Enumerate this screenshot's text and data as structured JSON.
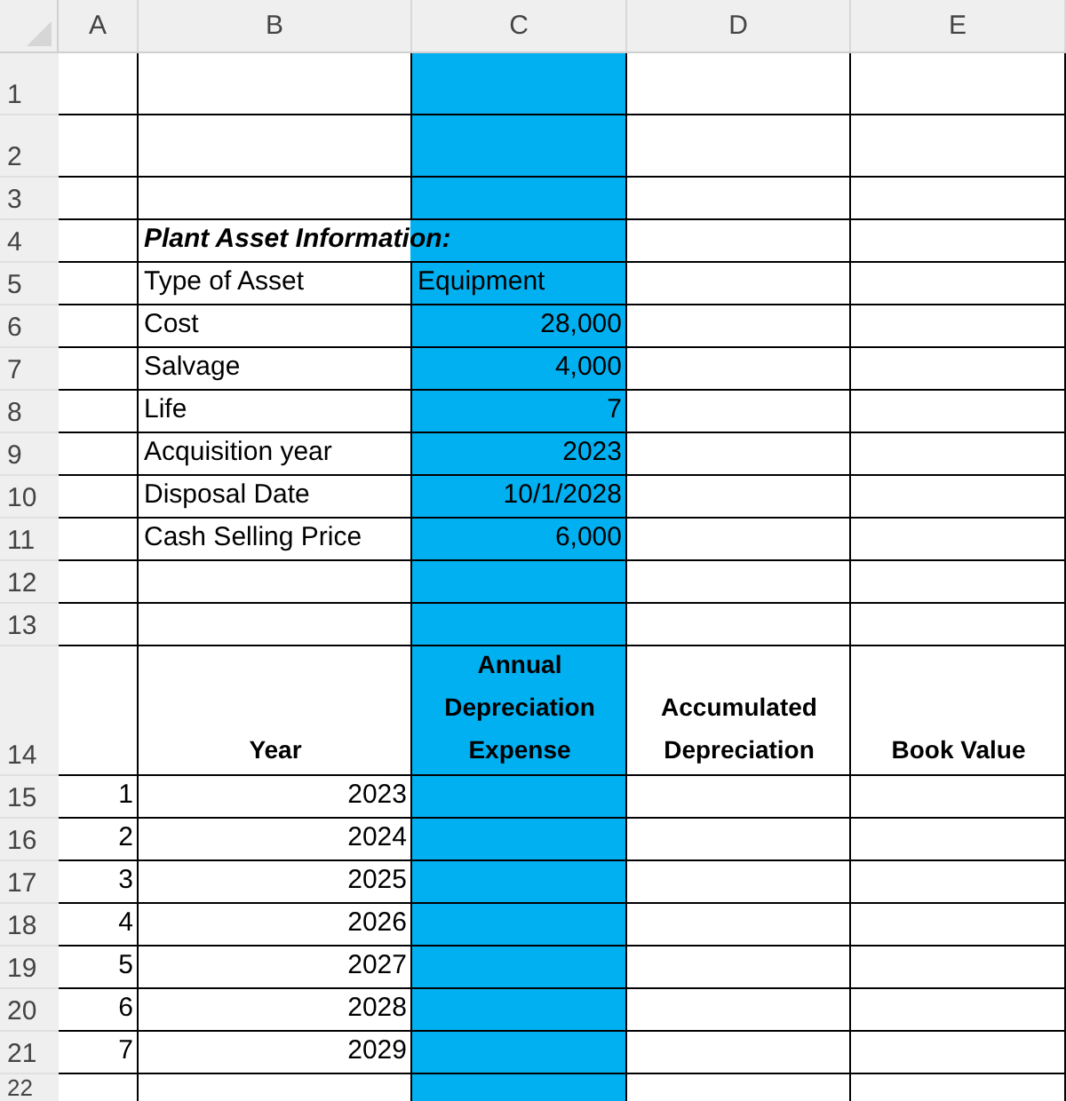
{
  "columns": [
    {
      "label": "A"
    },
    {
      "label": "B"
    },
    {
      "label": "C",
      "color": "#00b0f0"
    },
    {
      "label": "D"
    },
    {
      "label": "E"
    }
  ],
  "rows": [
    {
      "label": "1",
      "cells": {}
    },
    {
      "label": "2",
      "cells": {}
    },
    {
      "label": "3",
      "cells": {}
    },
    {
      "label": "4",
      "cells": {
        "B": {
          "text": "Plant Asset Information:",
          "kind": "title"
        }
      }
    },
    {
      "label": "5",
      "cells": {
        "B": {
          "text": "Type of Asset",
          "kind": "text"
        },
        "C": {
          "text": "Equipment",
          "kind": "text"
        }
      }
    },
    {
      "label": "6",
      "cells": {
        "B": {
          "text": "Cost",
          "kind": "text"
        },
        "C": {
          "text": "28,000",
          "kind": "number"
        }
      }
    },
    {
      "label": "7",
      "cells": {
        "B": {
          "text": "Salvage",
          "kind": "text"
        },
        "C": {
          "text": "4,000",
          "kind": "number"
        }
      }
    },
    {
      "label": "8",
      "cells": {
        "B": {
          "text": "Life",
          "kind": "text"
        },
        "C": {
          "text": "7",
          "kind": "number"
        }
      }
    },
    {
      "label": "9",
      "cells": {
        "B": {
          "text": "Acquisition year",
          "kind": "text"
        },
        "C": {
          "text": "2023",
          "kind": "number"
        }
      }
    },
    {
      "label": "10",
      "cells": {
        "B": {
          "text": "Disposal Date",
          "kind": "text"
        },
        "C": {
          "text": "10/1/2028",
          "kind": "number"
        }
      }
    },
    {
      "label": "11",
      "cells": {
        "B": {
          "text": "Cash Selling Price",
          "kind": "text"
        },
        "C": {
          "text": "6,000",
          "kind": "number"
        }
      }
    },
    {
      "label": "12",
      "cells": {}
    },
    {
      "label": "13",
      "cells": {}
    },
    {
      "label": "14",
      "cells": {
        "B": {
          "text": "Year",
          "kind": "heading"
        },
        "C": {
          "text": "Annual Depreciation Expense",
          "kind": "heading"
        },
        "D": {
          "text": "Accumulated Depreciation",
          "kind": "heading"
        },
        "E": {
          "text": "Book Value",
          "kind": "heading"
        }
      }
    },
    {
      "label": "15",
      "cells": {
        "A": {
          "text": "1",
          "kind": "number"
        },
        "B": {
          "text": "2023",
          "kind": "number"
        }
      }
    },
    {
      "label": "16",
      "cells": {
        "A": {
          "text": "2",
          "kind": "number"
        },
        "B": {
          "text": "2024",
          "kind": "number"
        }
      }
    },
    {
      "label": "17",
      "cells": {
        "A": {
          "text": "3",
          "kind": "number"
        },
        "B": {
          "text": "2025",
          "kind": "number"
        }
      }
    },
    {
      "label": "18",
      "cells": {
        "A": {
          "text": "4",
          "kind": "number"
        },
        "B": {
          "text": "2026",
          "kind": "number"
        }
      }
    },
    {
      "label": "19",
      "cells": {
        "A": {
          "text": "5",
          "kind": "number"
        },
        "B": {
          "text": "2027",
          "kind": "number"
        }
      }
    },
    {
      "label": "20",
      "cells": {
        "A": {
          "text": "6",
          "kind": "number"
        },
        "B": {
          "text": "2028",
          "kind": "number"
        }
      }
    },
    {
      "label": "21",
      "cells": {
        "A": {
          "text": "7",
          "kind": "number"
        },
        "B": {
          "text": "2029",
          "kind": "number"
        }
      }
    },
    {
      "label": "22",
      "cells": {}
    }
  ]
}
